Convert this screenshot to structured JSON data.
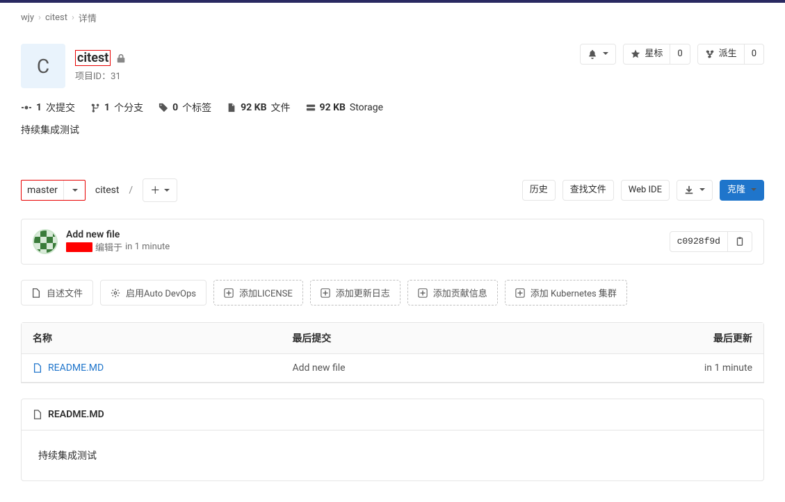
{
  "breadcrumb": {
    "root": "wjy",
    "project": "citest",
    "current": "详情"
  },
  "project": {
    "avatar_letter": "C",
    "name": "citest",
    "id_label": "项目ID：31",
    "description": "持续集成测试"
  },
  "header_actions": {
    "star_label": "星标",
    "star_count": "0",
    "fork_label": "派生",
    "fork_count": "0"
  },
  "stats": {
    "commits_count": "1",
    "commits_label": "次提交",
    "branches_count": "1",
    "branches_label": "个分支",
    "tags_count": "0",
    "tags_label": "个标签",
    "files_size": "92 KB",
    "files_label": "文件",
    "storage_size": "92 KB",
    "storage_label": "Storage"
  },
  "branch": {
    "selected": "master",
    "path": "citest",
    "history": "历史",
    "find_file": "查找文件",
    "web_ide": "Web IDE",
    "clone": "克隆"
  },
  "commit": {
    "message": "Add new file",
    "edited_label": "编辑于",
    "time": "in 1 minute",
    "sha": "c0928f9d"
  },
  "quick_actions": {
    "readme": "自述文件",
    "auto_devops": "启用Auto DevOps",
    "add_license": "添加LICENSE",
    "add_changelog": "添加更新日志",
    "add_contributing": "添加贡献信息",
    "add_kubernetes": "添加 Kubernetes 集群"
  },
  "table": {
    "th_name": "名称",
    "th_last_commit": "最后提交",
    "th_last_update": "最后更新",
    "rows": [
      {
        "name": "README.MD",
        "commit": "Add new file",
        "updated": "in 1 minute"
      }
    ]
  },
  "readme": {
    "filename": "README.MD",
    "content": "持续集成测试"
  }
}
